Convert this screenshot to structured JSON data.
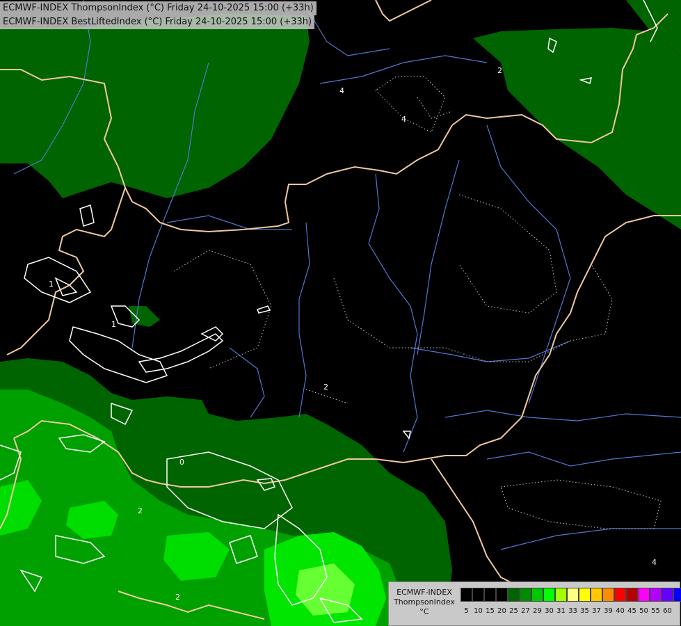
{
  "titles": {
    "line1": "ECMWF-INDEX ThompsonIndex (°C) Friday 24-10-2025 15:00 (+33h)",
    "line2": "ECMWF-INDEX BestLiftedIndex (°C) Friday 24-10-2025 15:00 (+33h)"
  },
  "legend": {
    "model": "ECMWF-INDEX",
    "parameter": "ThompsonIndex",
    "unit": "°C",
    "ticks": [
      "5",
      "10",
      "15",
      "20",
      "25",
      "27",
      "29",
      "30",
      "31",
      "33",
      "35",
      "37",
      "39",
      "40",
      "45",
      "50",
      "55",
      "60"
    ],
    "colors": [
      "#000000",
      "#000000",
      "#000000",
      "#000000",
      "#006400",
      "#008c00",
      "#00c800",
      "#00ff00",
      "#a0ff00",
      "#ffff80",
      "#ffff00",
      "#ffc800",
      "#ff8c00",
      "#ff0000",
      "#b40000",
      "#ff00ff",
      "#b400ff",
      "#6400ff",
      "#0000ff"
    ]
  },
  "contour_labels": [
    "1",
    "2",
    "2",
    "0",
    "2",
    "4",
    "4",
    "2",
    "1",
    "4"
  ],
  "colors": {
    "dark_green": "#006400",
    "mid_green": "#00a000",
    "bright_green": "#00e600",
    "border": "#f0c8a0",
    "river": "#5078d2",
    "lifted_contour": "#ffffff"
  }
}
